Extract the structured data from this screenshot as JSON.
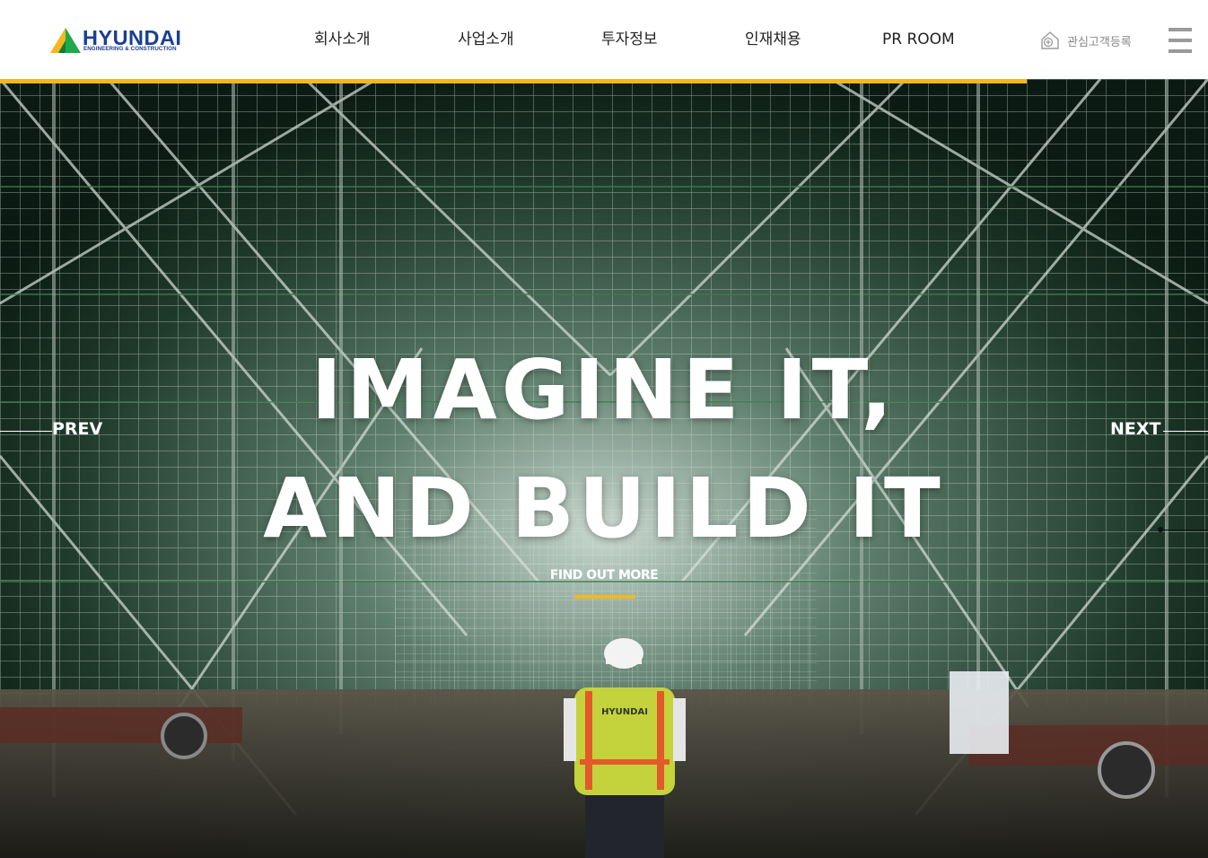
{
  "brand": {
    "name": "HYUNDAI",
    "tagline": "ENGINEERING & CONSTRUCTION",
    "colors": {
      "blue": "#1a3f92",
      "green": "#1fa94a",
      "yellow": "#f5b81c"
    }
  },
  "nav": {
    "items": [
      "회사소개",
      "사업소개",
      "투자정보",
      "인재채용",
      "PR ROOM"
    ]
  },
  "header_actions": {
    "interest_label": "관심고객등록",
    "interest_icon": "house-plus-icon",
    "menu_icon": "hamburger-menu-icon"
  },
  "hero": {
    "line1": "IMAGINE IT,",
    "line2": "AND BUILD IT",
    "cta": "FIND OUT MORE",
    "prev": "PREV",
    "next": "NEXT",
    "vest_text": "HYUNDAI"
  }
}
